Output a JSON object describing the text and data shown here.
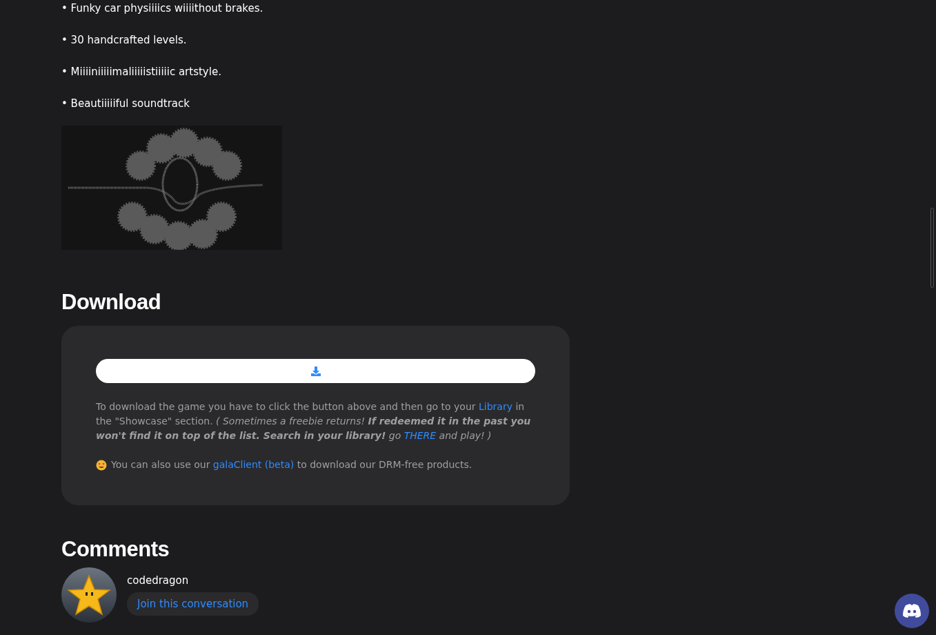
{
  "features": [
    "• Funky car physiiiics wiiiithout brakes.",
    "• 30 handcrafted levels.",
    "• Miiiiniiiiimaliiiiistiiiiic artstyle.",
    "• Beautiiiiiful soundtrack"
  ],
  "download": {
    "title": "Download",
    "instructions": [
      {
        "kind": "plain",
        "text": "To download the game you have to click the button above and then go to your "
      },
      {
        "kind": "link",
        "text": "Library"
      },
      {
        "kind": "plain",
        "text": " in the \"Showcase\" section. "
      },
      {
        "kind": "italic",
        "text": "( Sometimes a freebie returns! "
      },
      {
        "kind": "bolditalic",
        "text": "If redeemed it in the past you won't find it on top of the list. Search in your library!"
      },
      {
        "kind": "italic",
        "text": " go "
      },
      {
        "kind": "italiclink",
        "text": "THERE"
      },
      {
        "kind": "italic",
        "text": " and play! )"
      }
    ],
    "client_note": [
      {
        "kind": "plain",
        "text": "You can also use our "
      },
      {
        "kind": "link",
        "text": "galaClient (beta)"
      },
      {
        "kind": "plain",
        "text": " to download our DRM-free products."
      }
    ]
  },
  "comments": {
    "title": "Comments",
    "author": "codedragon",
    "action": "Join this conversation"
  }
}
